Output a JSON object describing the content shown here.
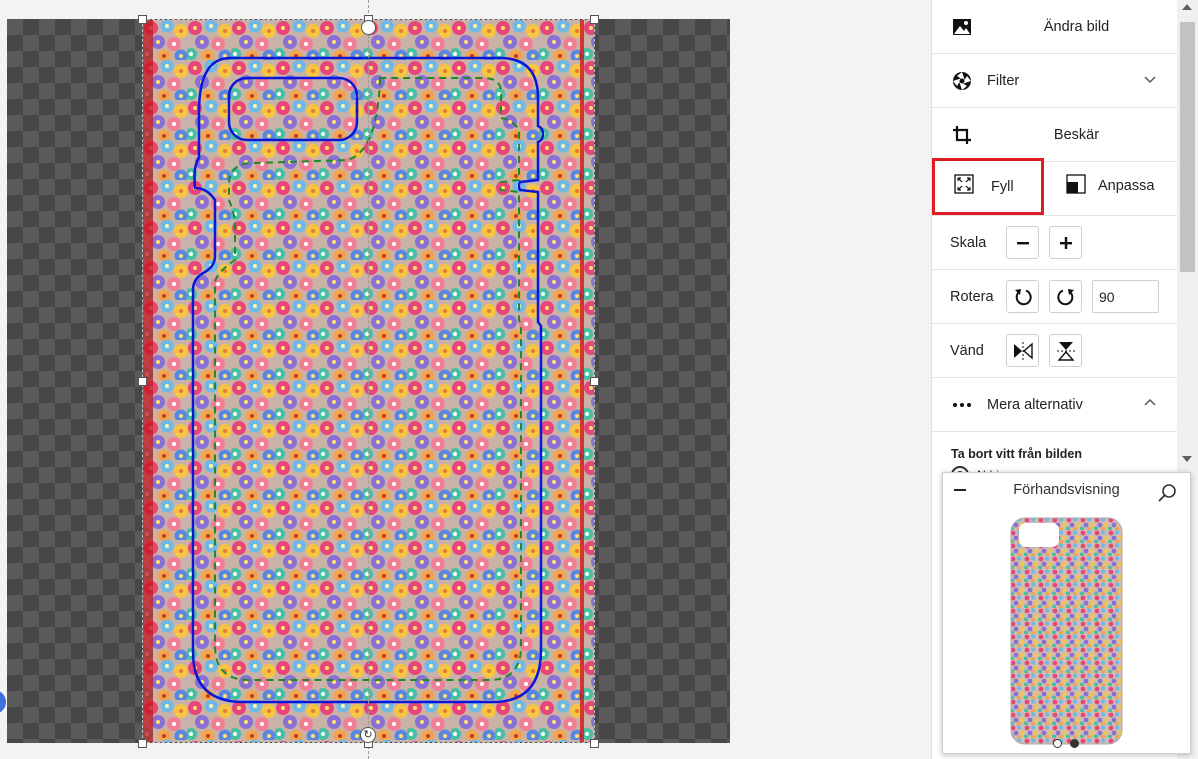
{
  "panel": {
    "change_image": "Ändra bild",
    "filter": "Filter",
    "crop": "Beskär",
    "fill": "Fyll",
    "fit": "Anpassa",
    "scale": "Skala",
    "rotate": "Rotera",
    "rotate_value": "90",
    "flip": "Vänd",
    "more_options": "Mera alternativ",
    "remove_white": "Ta bort vitt från bilden",
    "remove_white_option": "Aldrig"
  },
  "preview": {
    "title": "Förhandsvisning",
    "page_count": 2,
    "active_page": 2
  },
  "colors": {
    "accent": "#e01b24",
    "cutline": "#0a17d6",
    "safe_line": "#1f8a2a"
  },
  "icons": [
    "image-icon",
    "filter-icon",
    "chevron-down-icon",
    "crop-icon",
    "fill-icon",
    "fit-icon",
    "minus-icon",
    "plus-icon",
    "rotate-left-icon",
    "rotate-right-icon",
    "flip-horizontal-icon",
    "flip-vertical-icon",
    "more-icon",
    "chevron-up-icon",
    "search-icon"
  ]
}
